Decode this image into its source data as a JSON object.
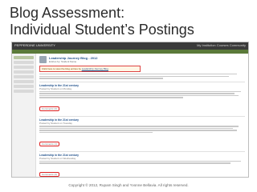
{
  "slide": {
    "title_line1": "Blog Assessment:",
    "title_line2": "Individual Student’s Postings",
    "footer": "Copyright © 2012, Rupam Singh and Yvonne Bellavia. All rights reserved."
  },
  "screenshot": {
    "brand": "PEPPERDINE UNIVERSITY",
    "topnav": "My Institution   Courses   Community",
    "tabs": [
      "Home",
      "Blogs",
      "Discussion",
      "Grades"
    ],
    "journal_title": "Leadership Journey Blog - 2012",
    "journal_meta": "Entries by: Student Name",
    "callout_text": "Click here to view the blog entries by",
    "callout_link": "Leadership Journey Blog",
    "entries": [
      {
        "title": "Leadership in the 21st century",
        "meta": "Posted by Student on Monday",
        "comment": "Comments (2)"
      },
      {
        "title": "Leadership in the 21st century",
        "meta": "Posted by Student on Tuesday",
        "comment": "Comments (1)"
      },
      {
        "title": "Leadership in the 21st century",
        "meta": "Posted by Student on Wednesday",
        "comment": "Comments (3)"
      }
    ]
  }
}
